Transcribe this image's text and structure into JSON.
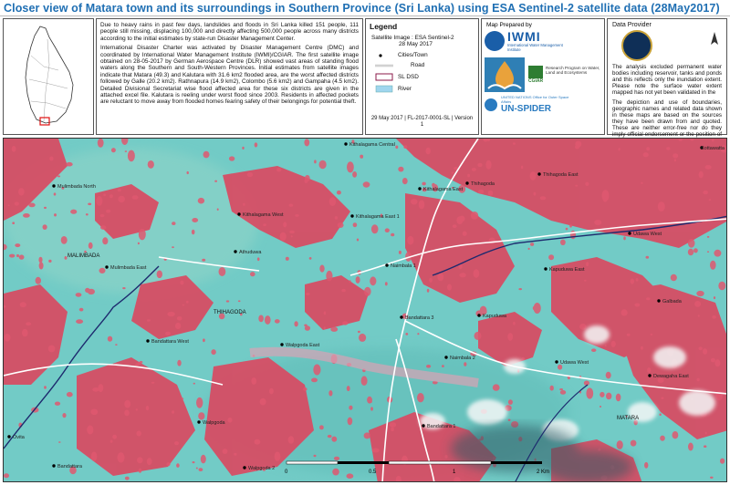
{
  "title": "Closer view of Matara town and its surroundings in Southern Province (Sri Lanka) using ESA Sentinel-2 satellite data (28May2017)",
  "description": {
    "p1": "Due to heavy rains in past few days, landslides and floods in Sri Lanka killed 151 people, 111 people still missing, displacing 100,000 and directly affecting 500,000 people across many districts according to the initial estimates by state-run Disaster Management Center.",
    "p2": "International Disaster Charter was activated by Disaster Management Centre (DMC) and coordinated by International Water Management Institute (IWMI)/CGIAR. The first satellite image obtained on 28-05-2017 by German Aerospace Centre (DLR) showed vast areas of standing flood waters along the Southern and South-Western Provinces. Initial estimates from satellite images indicate that Matara (49.3) and Kalutara with 31.6 km2 flooded area, are the worst affected districts followed by Galle (20.2 km2). Rathnapura (14.9 km2), Colombo (5.6 km2) and Gampaha (4.5 km2). Detailed Divisional Secretariat wise flood affected area for these six districts are given in the attached excel file. Kalutara is reeling under worst flood since 2003. Residents in affected pockets are reluctant to move away from flooded homes fearing safety of their belongings for potential theft."
  },
  "legend": {
    "title": "Legend",
    "satellite_image": "Satellite Image : ESA Sentinel-2",
    "image_date": "28 May 2017",
    "items": [
      "Cities/Town",
      "Road",
      "SL DSD",
      "River"
    ],
    "colors": {
      "river": "#9fd6ee",
      "dsd": "#8b1a4a",
      "road": "#ffffff"
    },
    "footer": "29 May 2017 | FL-2017-0001-SL | Version 1"
  },
  "logos": {
    "prepared_by": "Map Prepared by",
    "iwmi": "IWMI",
    "iwmi_sub": "International Water Management Institute",
    "cgiar": "CGIAR",
    "research": "Research Program on Water, Land and Ecosystems",
    "un_office": "UNITED NATIONS Office for Outer Space Affairs",
    "un_spider": "UN-SPIDER"
  },
  "provider": {
    "title": "Data Provider",
    "p1": "The analysis excluded permanent water bodies including reservoir, tanks and ponds and this reflects only the inundation extent. Please note the surface water extent mapped has not yet been validated in the",
    "p2": "The depiction and use of boundaries, geographic names and related data shown in these maps are based on the sources they have been drawn from and quoted. These are neither error-free nor do they imply official endorsement or the position of IWMI."
  },
  "map": {
    "towns": [
      {
        "name": "Kithalagama Central"
      },
      {
        "name": "Kottawatta"
      },
      {
        "name": "Thihagoda East"
      },
      {
        "name": "Mulimbada North"
      },
      {
        "name": "Kithalagama West"
      },
      {
        "name": "Kithalagama East"
      },
      {
        "name": "Thihagoda"
      },
      {
        "name": "Kithalagama East 1"
      },
      {
        "name": "Udawa West"
      },
      {
        "name": "Athuduwa"
      },
      {
        "name": "Naimbala 1"
      },
      {
        "name": "Kapuduwa East"
      },
      {
        "name": "Galbada"
      },
      {
        "name": "Mulimbada East"
      },
      {
        "name": "Bandattara 3"
      },
      {
        "name": "Kapuduwa"
      },
      {
        "name": "Bandattara West"
      },
      {
        "name": "Walpgoda East"
      },
      {
        "name": "Naimbala 2"
      },
      {
        "name": "Udawa West"
      },
      {
        "name": "Dewagaha East"
      },
      {
        "name": "Walpgoda"
      },
      {
        "name": "Bandattara 1"
      },
      {
        "name": "Walpgoda 2"
      },
      {
        "name": "Bandattara"
      },
      {
        "name": "Ovita"
      }
    ],
    "dsd_labels": [
      "MALIMBADA",
      "THIHAGODA",
      "MATARA"
    ],
    "scale_labels": [
      "0",
      "0.5",
      "1",
      "2 Km"
    ]
  }
}
